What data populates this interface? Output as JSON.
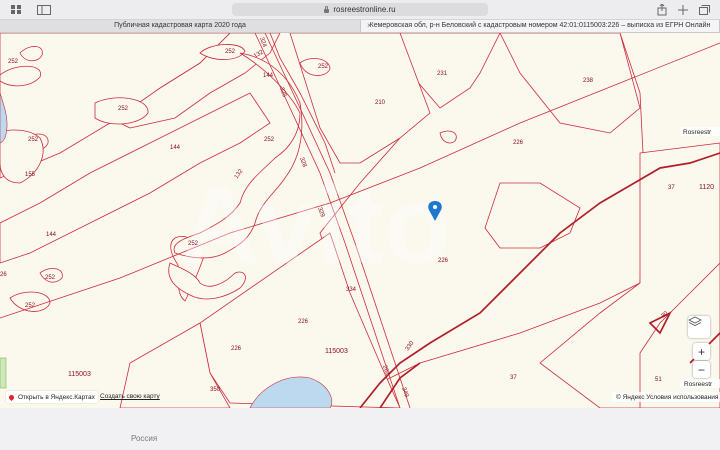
{
  "browser": {
    "url": "rosreestronline.ru",
    "tabs": [
      {
        "label": "Публичная кадастровая карта 2020 года",
        "active": false
      },
      {
        "label": "Кемеровская обл, р-н Беловский с кадастровым номером 42:01:0115003:226 – выписка из ЕГРН Онлайн",
        "active": true
      }
    ]
  },
  "map": {
    "parcel_labels": {
      "p252a": "252",
      "p252b": "252",
      "p252c": "252",
      "p252d": "252",
      "p252e": "252",
      "p252f": "252",
      "p252g": "252",
      "p252h": "252",
      "p144a": "144",
      "p144b": "144",
      "p144c": "144",
      "p155": "155",
      "p210": "210",
      "p231": "231",
      "p238": "238",
      "p226a": "226",
      "p226b": "226",
      "p226c": "226",
      "p226d": "226",
      "p37a": "37",
      "p37b": "37",
      "p1120": "1120",
      "p334": "334",
      "p350": "350",
      "p51": "51",
      "p324": "324",
      "p325": "325",
      "p328": "328",
      "p329": "329",
      "p26": "26",
      "p132a": "132",
      "p132b": "132",
      "p330": "330",
      "p262": "262",
      "p349": "349",
      "p30": "30"
    },
    "quarter_labels": {
      "q1": "115003",
      "q2": "115003"
    },
    "watermark": "Avito",
    "attribution_partial": "Rosreestr",
    "attribution_bottom": "Rosreestr",
    "yandex_terms": "© Яндекс Условия использования",
    "open_yandex": "Открыть в Яндекс.Картах",
    "create_map": "Создать свою карту",
    "zoom_in": "+",
    "zoom_out": "−",
    "colors": {
      "parcel_border": "#cc2b3c",
      "road": "#b11e2a",
      "background": "#fbf8ee",
      "water": "#bcd9ef",
      "marker": "#1f77d0"
    }
  },
  "footer": {
    "country": "Россия"
  }
}
